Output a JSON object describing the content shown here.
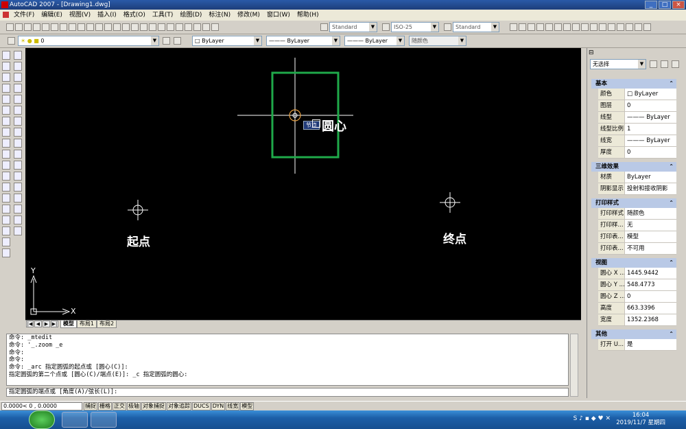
{
  "window": {
    "title": "AutoCAD 2007 - [Drawing1.dwg]"
  },
  "menu": [
    "文件(F)",
    "编辑(E)",
    "视图(V)",
    "插入(I)",
    "格式(O)",
    "工具(T)",
    "绘图(D)",
    "标注(N)",
    "修改(M)",
    "窗口(W)",
    "帮助(H)"
  ],
  "toolbar": {
    "text_style": "Standard",
    "dim_style": "ISO-25",
    "table_style": "Standard",
    "layer": "0",
    "color": "ByLayer",
    "linetype": "ByLayer",
    "lineweight": "ByLayer",
    "plotstyle": "随颜色"
  },
  "canvas": {
    "label_center": "圆心",
    "label_start": "起点",
    "label_end": "终点",
    "tooltip": "节点",
    "ucs_x": "X",
    "ucs_y": "Y",
    "snap_box_color": "#1faa4a"
  },
  "layout_tabs": [
    "模型",
    "布局1",
    "布局2"
  ],
  "command": {
    "history": [
      "命令: _mtedit",
      "命令: '_.zoom _e",
      "命令:",
      "命令:",
      "命令: _arc 指定圆弧的起点或 [圆心(C)]:",
      "指定圆弧的第二个点或 [圆心(C)/端点(E)]: _c 指定圆弧的圆心:"
    ],
    "prompt": "指定圆弧的端点或 [角度(A)/弦长(L)]:"
  },
  "status": {
    "coords": "0.0000<    0     , 0.0000",
    "buttons": [
      "捕捉",
      "栅格",
      "正交",
      "极轴",
      "对象捕捉",
      "对象追踪",
      "DUCS",
      "DYN",
      "线宽",
      "模型"
    ]
  },
  "properties": {
    "selection": "无选择",
    "sections": [
      {
        "title": "基本",
        "rows": [
          [
            "颜色",
            "□ ByLayer"
          ],
          [
            "图层",
            "0"
          ],
          [
            "线型",
            "——— ByLayer"
          ],
          [
            "线型比例",
            "1"
          ],
          [
            "线宽",
            "——— ByLayer"
          ],
          [
            "厚度",
            "0"
          ]
        ]
      },
      {
        "title": "三维效果",
        "rows": [
          [
            "材质",
            "ByLayer"
          ],
          [
            "阴影显示",
            "投射和接收阴影"
          ]
        ]
      },
      {
        "title": "打印样式",
        "rows": [
          [
            "打印样式",
            "随颜色"
          ],
          [
            "打印样...",
            "无"
          ],
          [
            "打印表...",
            "模型"
          ],
          [
            "打印表...",
            "不可用"
          ]
        ]
      },
      {
        "title": "视图",
        "rows": [
          [
            "圆心 X ...",
            "1445.9442"
          ],
          [
            "圆心 Y ...",
            "548.4773"
          ],
          [
            "圆心 Z ...",
            "0"
          ],
          [
            "高度",
            "663.3396"
          ],
          [
            "宽度",
            "1352.2368"
          ]
        ]
      },
      {
        "title": "其他",
        "rows": [
          [
            "打开 U...",
            "是"
          ]
        ]
      }
    ]
  },
  "taskbar": {
    "time": "16:04",
    "date": "2019/11/7 星期四"
  }
}
